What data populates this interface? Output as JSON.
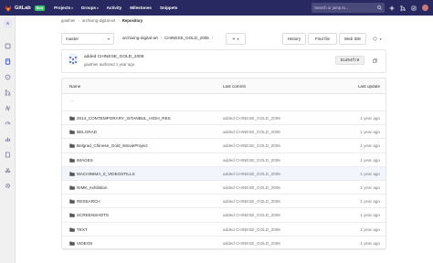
{
  "navbar": {
    "brand": "GitLab",
    "badge": "Next",
    "links": [
      "Projects",
      "Groups",
      "Activity",
      "Milestones",
      "Snippets"
    ],
    "search_placeholder": "Search or jump to...",
    "bg_color": "#292961"
  },
  "sidebar": {
    "project_initial": "A",
    "icons": [
      "project-overview-icon",
      "repository-icon",
      "issues-icon",
      "merge-requests-icon",
      "ci-cd-icon",
      "operations-icon",
      "analytics-icon",
      "wiki-icon",
      "snippets-icon",
      "settings-icon"
    ]
  },
  "breadcrumb": {
    "namespace": "gauthier",
    "project": "archiving-digital-art",
    "page": "Repository"
  },
  "toolbar": {
    "branch": "master",
    "path_root": "archiving-digital-art",
    "path_dir": "CHINESE_GOLD_2006",
    "add_label": "+",
    "history_label": "History",
    "find_file_label": "Find file",
    "web_ide_label": "Web IDE"
  },
  "commit": {
    "title": "added CHINESE_GOLD_2006",
    "meta": "gauthier authored 1 year ago",
    "sha": "b1d54fc0"
  },
  "table": {
    "headers": {
      "name": "Name",
      "last_commit": "Last commit",
      "last_update": "Last update"
    },
    "up_dir": "..",
    "rows": [
      {
        "name": "2014_CONTEMPORARY_ISTANBUL_HIGH_RES",
        "commit": "added CHINESE_GOLD_2006",
        "date": "1 year ago"
      },
      {
        "name": "BELGRAD",
        "commit": "added CHINESE_GOLD_2006",
        "date": "1 year ago"
      },
      {
        "name": "Belgrad_Chinese_Gold_iMovieProject",
        "commit": "added CHINESE_GOLD_2006",
        "date": "1 year ago"
      },
      {
        "name": "IMAGES",
        "commit": "added CHINESE_GOLD_2006",
        "date": "1 year ago"
      },
      {
        "name": "MACHINIMA_0_VIDEOSTILLS",
        "commit": "added CHINESE_GOLD_2006",
        "date": "1 year ago"
      },
      {
        "name": "NIMK_exhibition",
        "commit": "added CHINESE_GOLD_2006",
        "date": "1 year ago"
      },
      {
        "name": "RESEARCH",
        "commit": "added CHINESE_GOLD_2006",
        "date": "1 year ago"
      },
      {
        "name": "SCREENSHOTS",
        "commit": "added CHINESE_GOLD_2006",
        "date": "1 year ago"
      },
      {
        "name": "TEXT",
        "commit": "added CHINESE_GOLD_2006",
        "date": "1 year ago"
      },
      {
        "name": "VIDEOS",
        "commit": "added CHINESE_GOLD_2006",
        "date": "1 year ago"
      }
    ]
  }
}
